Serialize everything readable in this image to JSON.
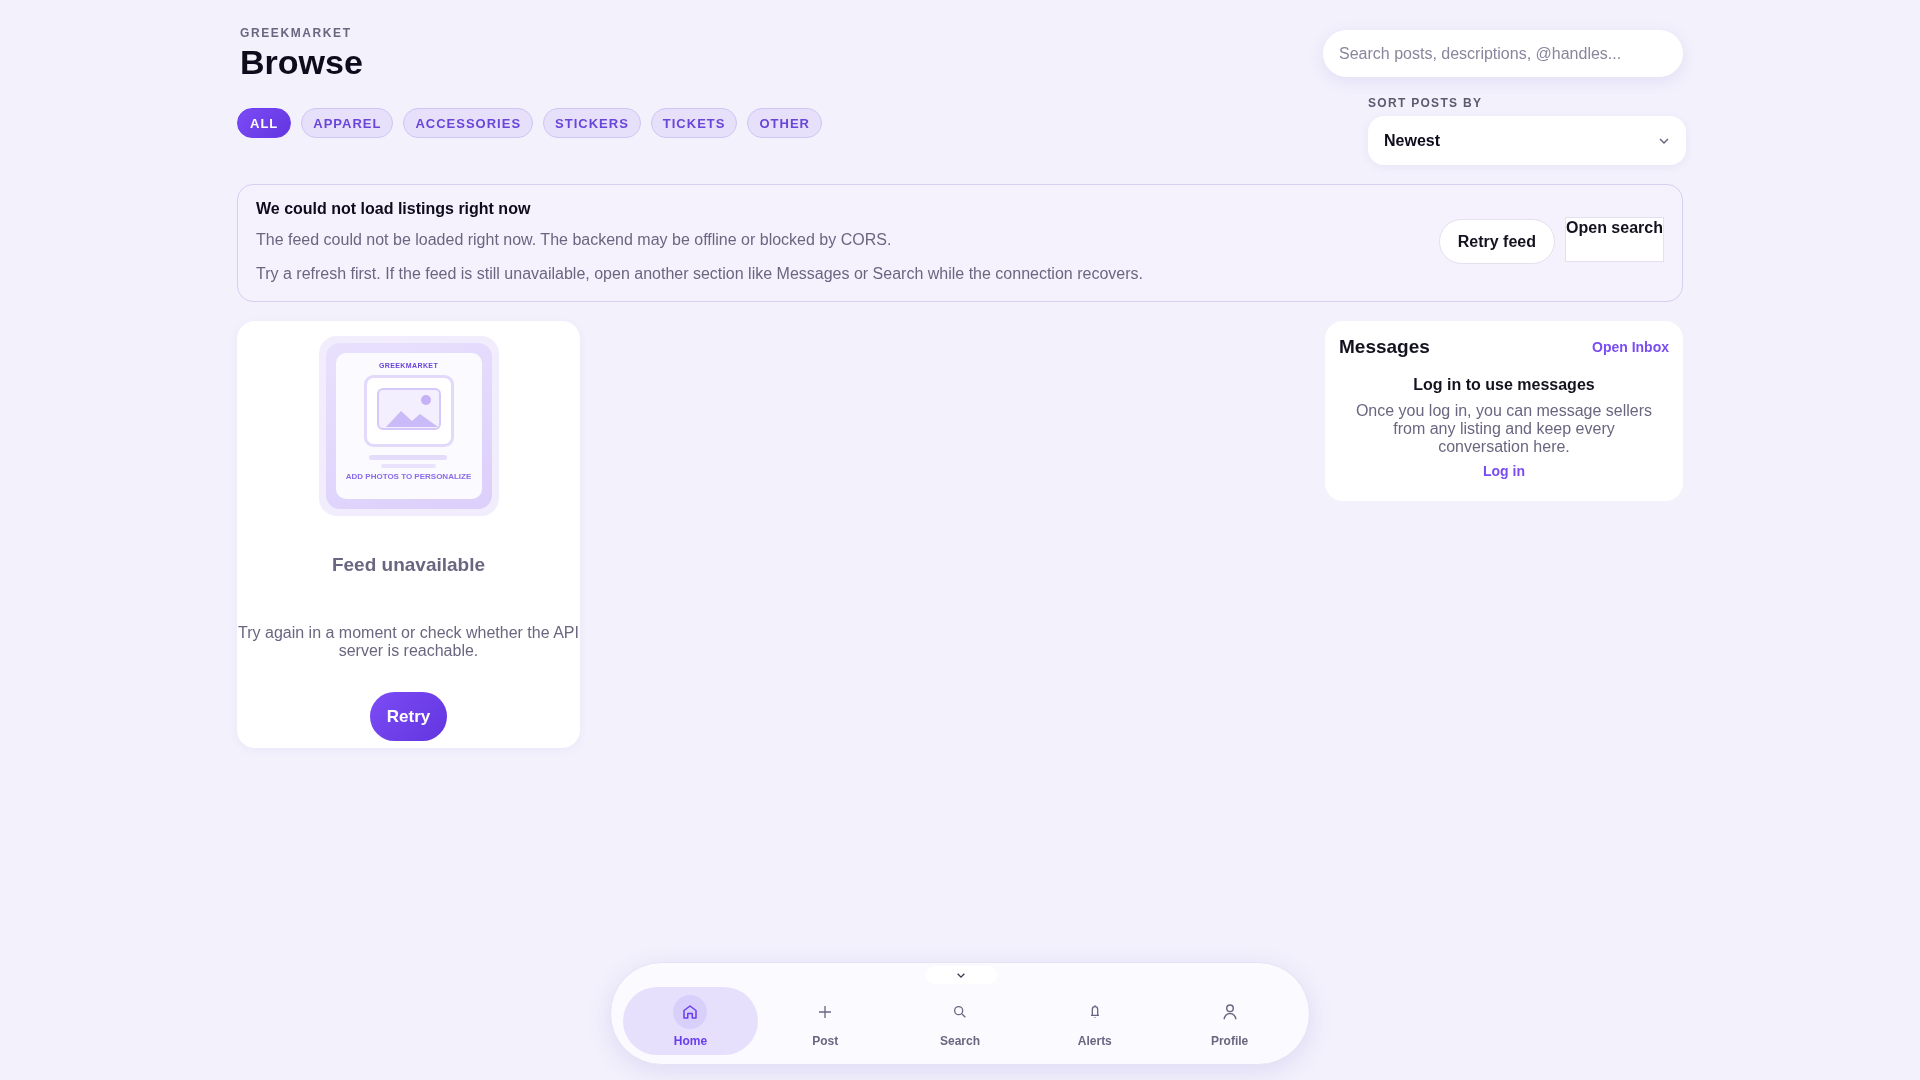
{
  "brand": "GREEKMARKET",
  "title": "Browse",
  "categories": [
    {
      "label": "ALL",
      "selected": true
    },
    {
      "label": "APPAREL",
      "selected": false
    },
    {
      "label": "ACCESSORIES",
      "selected": false
    },
    {
      "label": "STICKERS",
      "selected": false
    },
    {
      "label": "TICKETS",
      "selected": false
    },
    {
      "label": "OTHER",
      "selected": false
    }
  ],
  "search": {
    "placeholder": "Search posts, descriptions, @handles..."
  },
  "sort": {
    "label": "SORT POSTS BY",
    "value": "Newest"
  },
  "alert": {
    "title": "We could not load listings right now",
    "lines": [
      "The feed could not be loaded right now. The backend may be offline or blocked by CORS.",
      "Try a refresh first. If the feed is still unavailable, open another section like Messages or Search while the connection recovers."
    ],
    "buttons": [
      {
        "label": "Retry feed",
        "kind": "pill"
      },
      {
        "label": "Open search",
        "kind": "plain"
      }
    ]
  },
  "feed_card": {
    "illustration": {
      "brand": "GREEKMARKET",
      "caption": "ADD PHOTOS TO PERSONALIZE"
    },
    "title": "Feed unavailable",
    "message": "Try again in a moment or check whether the API server is reachable.",
    "button": "Retry"
  },
  "messages": {
    "title": "Messages",
    "link": "Open Inbox",
    "heading": "Log in to use messages",
    "body": "Once you log in, you can message sellers from any listing and keep every conversation here.",
    "login": "Log in"
  },
  "nav": [
    {
      "label": "Home",
      "selected": true
    },
    {
      "label": "Post",
      "selected": false
    },
    {
      "label": "Search",
      "selected": false
    },
    {
      "label": "Alerts",
      "selected": false
    },
    {
      "label": "Profile",
      "selected": false
    }
  ]
}
